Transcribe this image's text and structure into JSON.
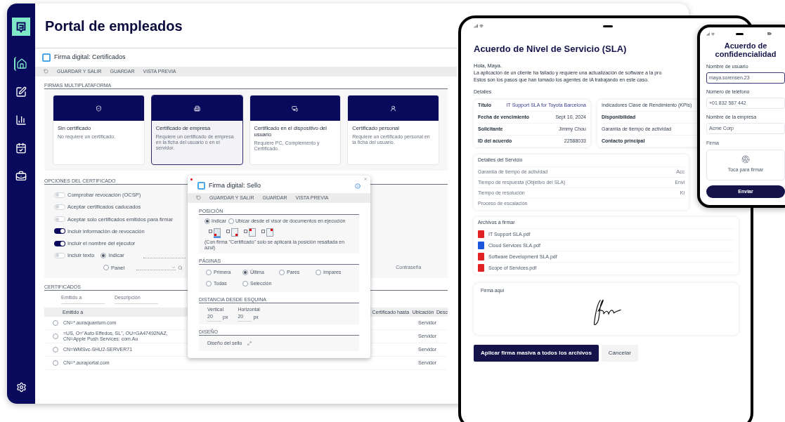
{
  "portal": {
    "title": "Portal de empleados",
    "nav": [
      {
        "kind": "home",
        "selected": true
      },
      {
        "kind": "edit",
        "selected": false
      },
      {
        "kind": "chart",
        "selected": false
      },
      {
        "kind": "calendar",
        "selected": false
      },
      {
        "kind": "briefcase",
        "selected": false
      }
    ],
    "window_title": "Firma digital: Certificados",
    "toolbar": [
      "GUARDAR Y SALIR",
      "GUARDAR",
      "VISTA PREVIA"
    ],
    "section_title": "FIRMAS MULTIPLATAFORMA",
    "cards": [
      {
        "kind": "shield",
        "title": "Sin certificado",
        "description": "No requiere un certificado.",
        "selected": false
      },
      {
        "kind": "building",
        "title": "Certificado de empresa",
        "description": "Requiere un certificado de empresa en la ficha del usuario o en el servidor.",
        "selected": true
      },
      {
        "kind": "device",
        "title": "Certificado en el dispositivo del usuario",
        "description": "Requiere PC, Complemento y Certificado.",
        "selected": false
      },
      {
        "kind": "user",
        "title": "Certificado personal",
        "description": "Requiere un certificado personal en la ficha del usuario.",
        "selected": false
      }
    ],
    "options_title": "OPCIONES DEL CERTIFICADO",
    "options": [
      {
        "label": "Comprobar revocación (OCSP)",
        "on": false
      },
      {
        "label": "Aceptar certificados caducados",
        "on": false
      },
      {
        "label": "Aceptar solo certificados emitidos para firmar",
        "on": false
      },
      {
        "label": "Incluir información de revocación",
        "on": true
      },
      {
        "label": "Incluir el nombre del ejecutor",
        "on": true
      },
      {
        "label": "Incluir texto",
        "on": false
      }
    ],
    "text_sources": [
      {
        "label": "Indicar",
        "selected": true
      },
      {
        "label": "Panel",
        "selected": false
      }
    ],
    "password_label": "Contraseña",
    "certs_title": "CERTIFICADOS",
    "filters": [
      "Emitido a",
      "Descripción"
    ],
    "columns": [
      "Emitido a",
      "Certificado hasta",
      "Ubicación",
      "Desc"
    ],
    "rows": [
      {
        "subject": "CN=*.auraquantum.com",
        "location": "Servidor",
        "selected": false
      },
      {
        "subject": "=US, O=\"Auto Effedos, SL\", OU=GA47492NAZ, CN=Apple Push Services: com.Au",
        "location": "Servidor",
        "selected": false
      },
      {
        "subject": "CN=WMSvc-SHU2-SERVER71",
        "location": "Servidor",
        "selected": false
      },
      {
        "subject": "CN=*.auraportal.com",
        "location": "Servidor",
        "selected": false
      }
    ]
  },
  "dialog": {
    "title": "Firma digital: Sello",
    "toolbar": [
      "GUARDAR Y SALIR",
      "GUARDAR",
      "VISTA PREVIA"
    ],
    "position_title": "POSICIÓN",
    "position_modes": [
      {
        "label": "Indicar",
        "selected": true
      },
      {
        "label": "Ubicar desde el visor de documentos en ejecución",
        "selected": false
      }
    ],
    "corners": [
      {
        "kind": "bottom-left",
        "checked": false,
        "selected": true
      },
      {
        "kind": "bottom-right",
        "checked": false,
        "selected": false
      },
      {
        "kind": "top-left",
        "checked": false,
        "selected": false
      },
      {
        "kind": "top-right",
        "checked": false,
        "selected": false
      }
    ],
    "note": "(Con firma \"Certificado\" solo se aplicará la posición resaltada en azul)",
    "pages_title": "PÁGINAS",
    "pages": [
      {
        "label": "Primera",
        "selected": false
      },
      {
        "label": "Última",
        "selected": true
      },
      {
        "label": "Pares",
        "selected": false
      },
      {
        "label": "Impares",
        "selected": false
      },
      {
        "label": "Todas",
        "selected": false
      },
      {
        "label": "Selección",
        "selected": false
      }
    ],
    "distance_title": "DISTANCIA DESDE ESQUINA",
    "distances": [
      {
        "label": "Vertical",
        "value": "20",
        "unit": "px"
      },
      {
        "label": "Horizontal",
        "value": "20",
        "unit": "px"
      }
    ],
    "design_title": "DISEÑO",
    "design_label": "Diseño del sello"
  },
  "tablet": {
    "title": "Acuerdo de Nivel de Servicio (SLA)",
    "greeting": "Hola, Maya.",
    "intro": [
      "La aplicación de un cliente ha fallado y requiere una actualización de software a la pro",
      "Estos son los pasos que han tomado los agentes de IA trabajando en este caso."
    ],
    "details_title": "Detalles",
    "details": [
      {
        "label": "Título",
        "value": "IT Support SLA for Toyota Barcelona"
      },
      {
        "label": "Fecha de vencimiento",
        "value": "Sept 10, 2024"
      },
      {
        "label": "Solicitante",
        "value": "Jimmy Chou"
      },
      {
        "label": "ID del acuerdo",
        "value": "22588033"
      }
    ],
    "kpis": [
      "Indicadores Clave de Rendimiento (KPIs)",
      "Disponibilidad",
      "Garantía de tiempo de actividad",
      "Contacto principal"
    ],
    "service_title": "Detalles del Servicio",
    "service": [
      {
        "label": "Garantía de tiempo de actividad",
        "value": "Acc"
      },
      {
        "label": "Tiempo de respuesta (Objetivo del SLA)",
        "value": "Envi"
      },
      {
        "label": "Tiempo de resolución",
        "value": "Ki"
      },
      {
        "label": "Proceso de escalación"
      }
    ],
    "files_title": "Archivos a firmar",
    "files": [
      {
        "name": "IT Support SLA.pdf",
        "color": "#e02424"
      },
      {
        "name": "Cloud Services SLA.pdf",
        "color": "#1a56db"
      },
      {
        "name": "Software Development SLA.pdf",
        "color": "#e02424"
      },
      {
        "name": "Scope of Services.pdf",
        "color": "#e02424"
      }
    ],
    "sign_label": "Firma aquí",
    "primary_button": "Aplicar firma masiva a todos los archivos",
    "secondary_button": "Cancelar"
  },
  "phone": {
    "title": "Acuerdo de confidencialidad",
    "fields": [
      {
        "label": "Nombre de usuario",
        "value": "maya.sorensen.23",
        "focused": true
      },
      {
        "label": "Número de teléfono",
        "value": "+01 832 587 442",
        "focused": false
      },
      {
        "label": "Nombre de la empresa",
        "value": "Acme Corp",
        "focused": false
      }
    ],
    "sign_label": "Firma",
    "sign_hint": "Toca para firmar",
    "submit": "Enviar"
  }
}
